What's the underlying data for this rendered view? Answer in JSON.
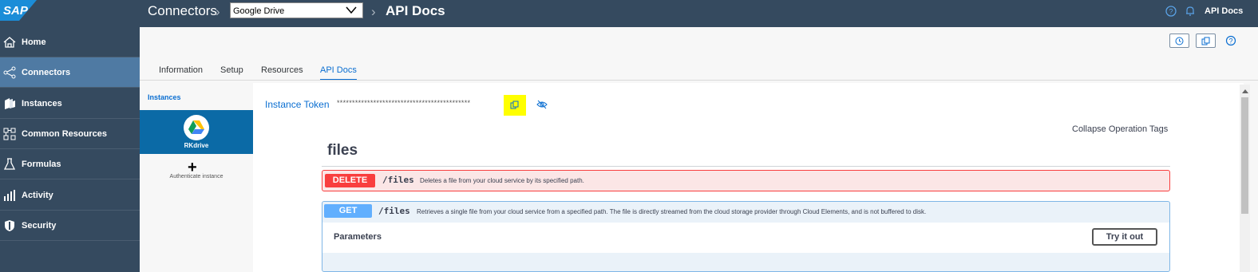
{
  "topbar": {
    "logo_text": "SAP",
    "breadcrumb_root": "Connectors",
    "selected_connector": "Google Drive",
    "current_page": "API Docs",
    "user_label": "API Docs",
    "icons": [
      "help-icon",
      "bell-icon"
    ]
  },
  "sidebar": {
    "items": [
      {
        "label": "Home",
        "icon": "home-icon"
      },
      {
        "label": "Connectors",
        "icon": "share-icon"
      },
      {
        "label": "Instances",
        "icon": "instances-icon"
      },
      {
        "label": "Common Resources",
        "icon": "network-icon"
      },
      {
        "label": "Formulas",
        "icon": "flask-icon"
      },
      {
        "label": "Activity",
        "icon": "bar-chart-icon"
      },
      {
        "label": "Security",
        "icon": "shield-icon"
      }
    ],
    "active": "Connectors"
  },
  "tabs": [
    "Information",
    "Setup",
    "Resources",
    "API Docs"
  ],
  "active_tab": "API Docs",
  "instances": {
    "title": "Instances",
    "card_name": "RKdrive",
    "authenticate_label": "Authenticate instance"
  },
  "token": {
    "label": "Instance Token",
    "masked_value": "********************************************"
  },
  "docs": {
    "collapse_label": "Collapse Operation Tags",
    "tag_title": "files",
    "operations": [
      {
        "method": "DELETE",
        "path": "/files",
        "summary": "Deletes a file from your cloud service by its specified path.",
        "color": "#f93e3e"
      },
      {
        "method": "GET",
        "path": "/files",
        "summary": "Retrieves a single file from your cloud service from a specified path. The file is directly streamed from the cloud storage provider through Cloud Elements, and is not buffered to disk.",
        "color": "#61affe"
      }
    ],
    "parameters_label": "Parameters",
    "try_label": "Try it out"
  },
  "colors": {
    "shell": "#354a5f",
    "active_nav": "#4f7aa3",
    "accent": "#0a6ed1",
    "highlight": "#ffff00"
  }
}
